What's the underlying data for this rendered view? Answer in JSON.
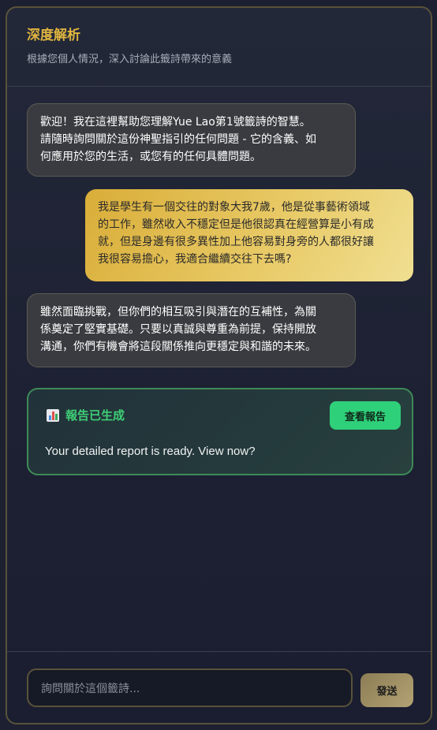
{
  "header": {
    "title": "深度解析",
    "subtitle": "根據您個人情況，深入討論此籤詩帶來的意義"
  },
  "messages": [
    {
      "role": "assistant",
      "text": "歡迎！我在這裡幫助您理解Yue Lao第1號籤詩的智慧。\n請隨時詢問關於這份神聖指引的任何問題 - 它的含義、如\n何應用於您的生活，或您有的任何具體問題。"
    },
    {
      "role": "user",
      "text": "我是學生有一個交往的對象大我7歲，他是從事藝術領域\n的工作，雖然收入不穩定但是他很認真在經營算是小有成\n就，但是身邊有很多異性加上他容易對身旁的人都很好讓\n我很容易擔心，我適合繼續交往下去嗎?"
    },
    {
      "role": "assistant",
      "text": "雖然面臨挑戰，但你們的相互吸引與潛在的互補性，為關\n係奠定了堅實基礎。只要以真誠與尊重為前提，保持開放\n溝通，你們有機會將這段關係推向更穩定與和諧的未來。"
    }
  ],
  "report": {
    "icon": "bar-chart-icon",
    "title": "報告已生成",
    "button_label": "查看報告",
    "text": "Your detailed report is ready. View now?"
  },
  "composer": {
    "placeholder": "詢問關於這個籤詩...",
    "send_label": "發送"
  },
  "colors": {
    "accent_gold": "#e0b53f",
    "report_green": "#2fd07a"
  }
}
